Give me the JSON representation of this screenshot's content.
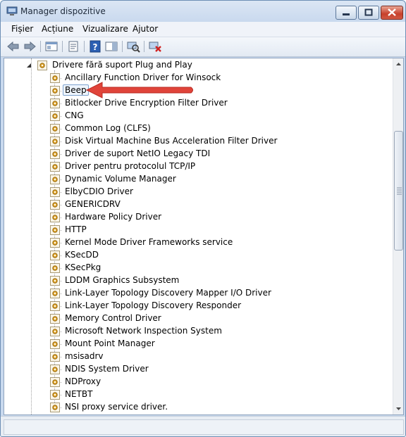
{
  "window": {
    "title": "Manager dispozitive"
  },
  "menu": {
    "items": [
      "Fișier",
      "Acțiune",
      "Vizualizare",
      "Ajutor"
    ]
  },
  "tree": {
    "parent_label": "Drivere fără suport Plug and Play",
    "selected_index": 1,
    "items": [
      "Ancillary Function Driver for Winsock",
      "Beep",
      "Bitlocker Drive Encryption Filter Driver",
      "CNG",
      "Common Log (CLFS)",
      "Disk Virtual Machine Bus Acceleration Filter Driver",
      "Driver de suport NetIO Legacy TDI",
      "Driver pentru protocolul TCP/IP",
      "Dynamic Volume Manager",
      "ElbyCDIO Driver",
      "GENERICDRV",
      "Hardware Policy Driver",
      "HTTP",
      "Kernel Mode Driver Frameworks service",
      "KSecDD",
      "KSecPkg",
      "LDDM Graphics Subsystem",
      "Link-Layer Topology Discovery Mapper I/O Driver",
      "Link-Layer Topology Discovery Responder",
      "Memory Control Driver",
      "Microsoft Network Inspection System",
      "Mount Point Manager",
      "msisadrv",
      "NDIS System Driver",
      "NDProxy",
      "NETBT",
      "NSI proxy service driver."
    ]
  },
  "colors": {
    "accent_arrow": "#e0443a",
    "selection_border": "#7da2ce"
  }
}
